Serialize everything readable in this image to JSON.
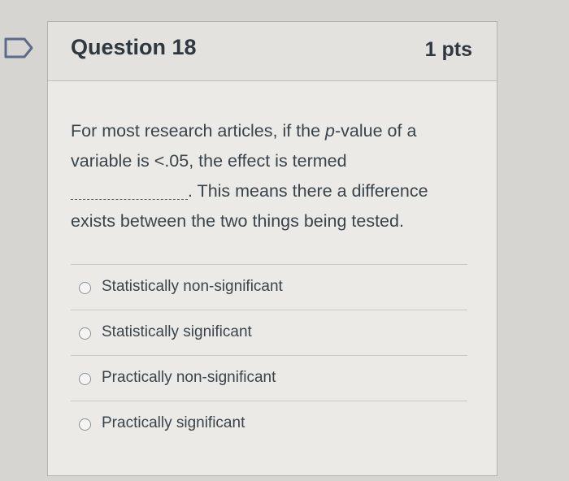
{
  "question": {
    "title": "Question 18",
    "points": "1 pts",
    "text": {
      "line1_before_p": "For most research articles, if the ",
      "line1_p": "p",
      "line1_after_p": "-value of a",
      "line2": "variable is <.05, the effect is termed",
      "line3_after_blank": ". This means there a difference",
      "line4": "exists between the two things being tested."
    },
    "answers": [
      {
        "label": "Statistically non-significant",
        "selected": false
      },
      {
        "label": "Statistically significant",
        "selected": false
      },
      {
        "label": "Practically non-significant",
        "selected": false
      },
      {
        "label": "Practically significant",
        "selected": false
      }
    ]
  },
  "icons": {
    "flag": "bookmark-flag-icon",
    "radio": "radio-button-icon"
  },
  "colors": {
    "flag_outline": "#5b6b8c",
    "text": "#2d3b45"
  }
}
